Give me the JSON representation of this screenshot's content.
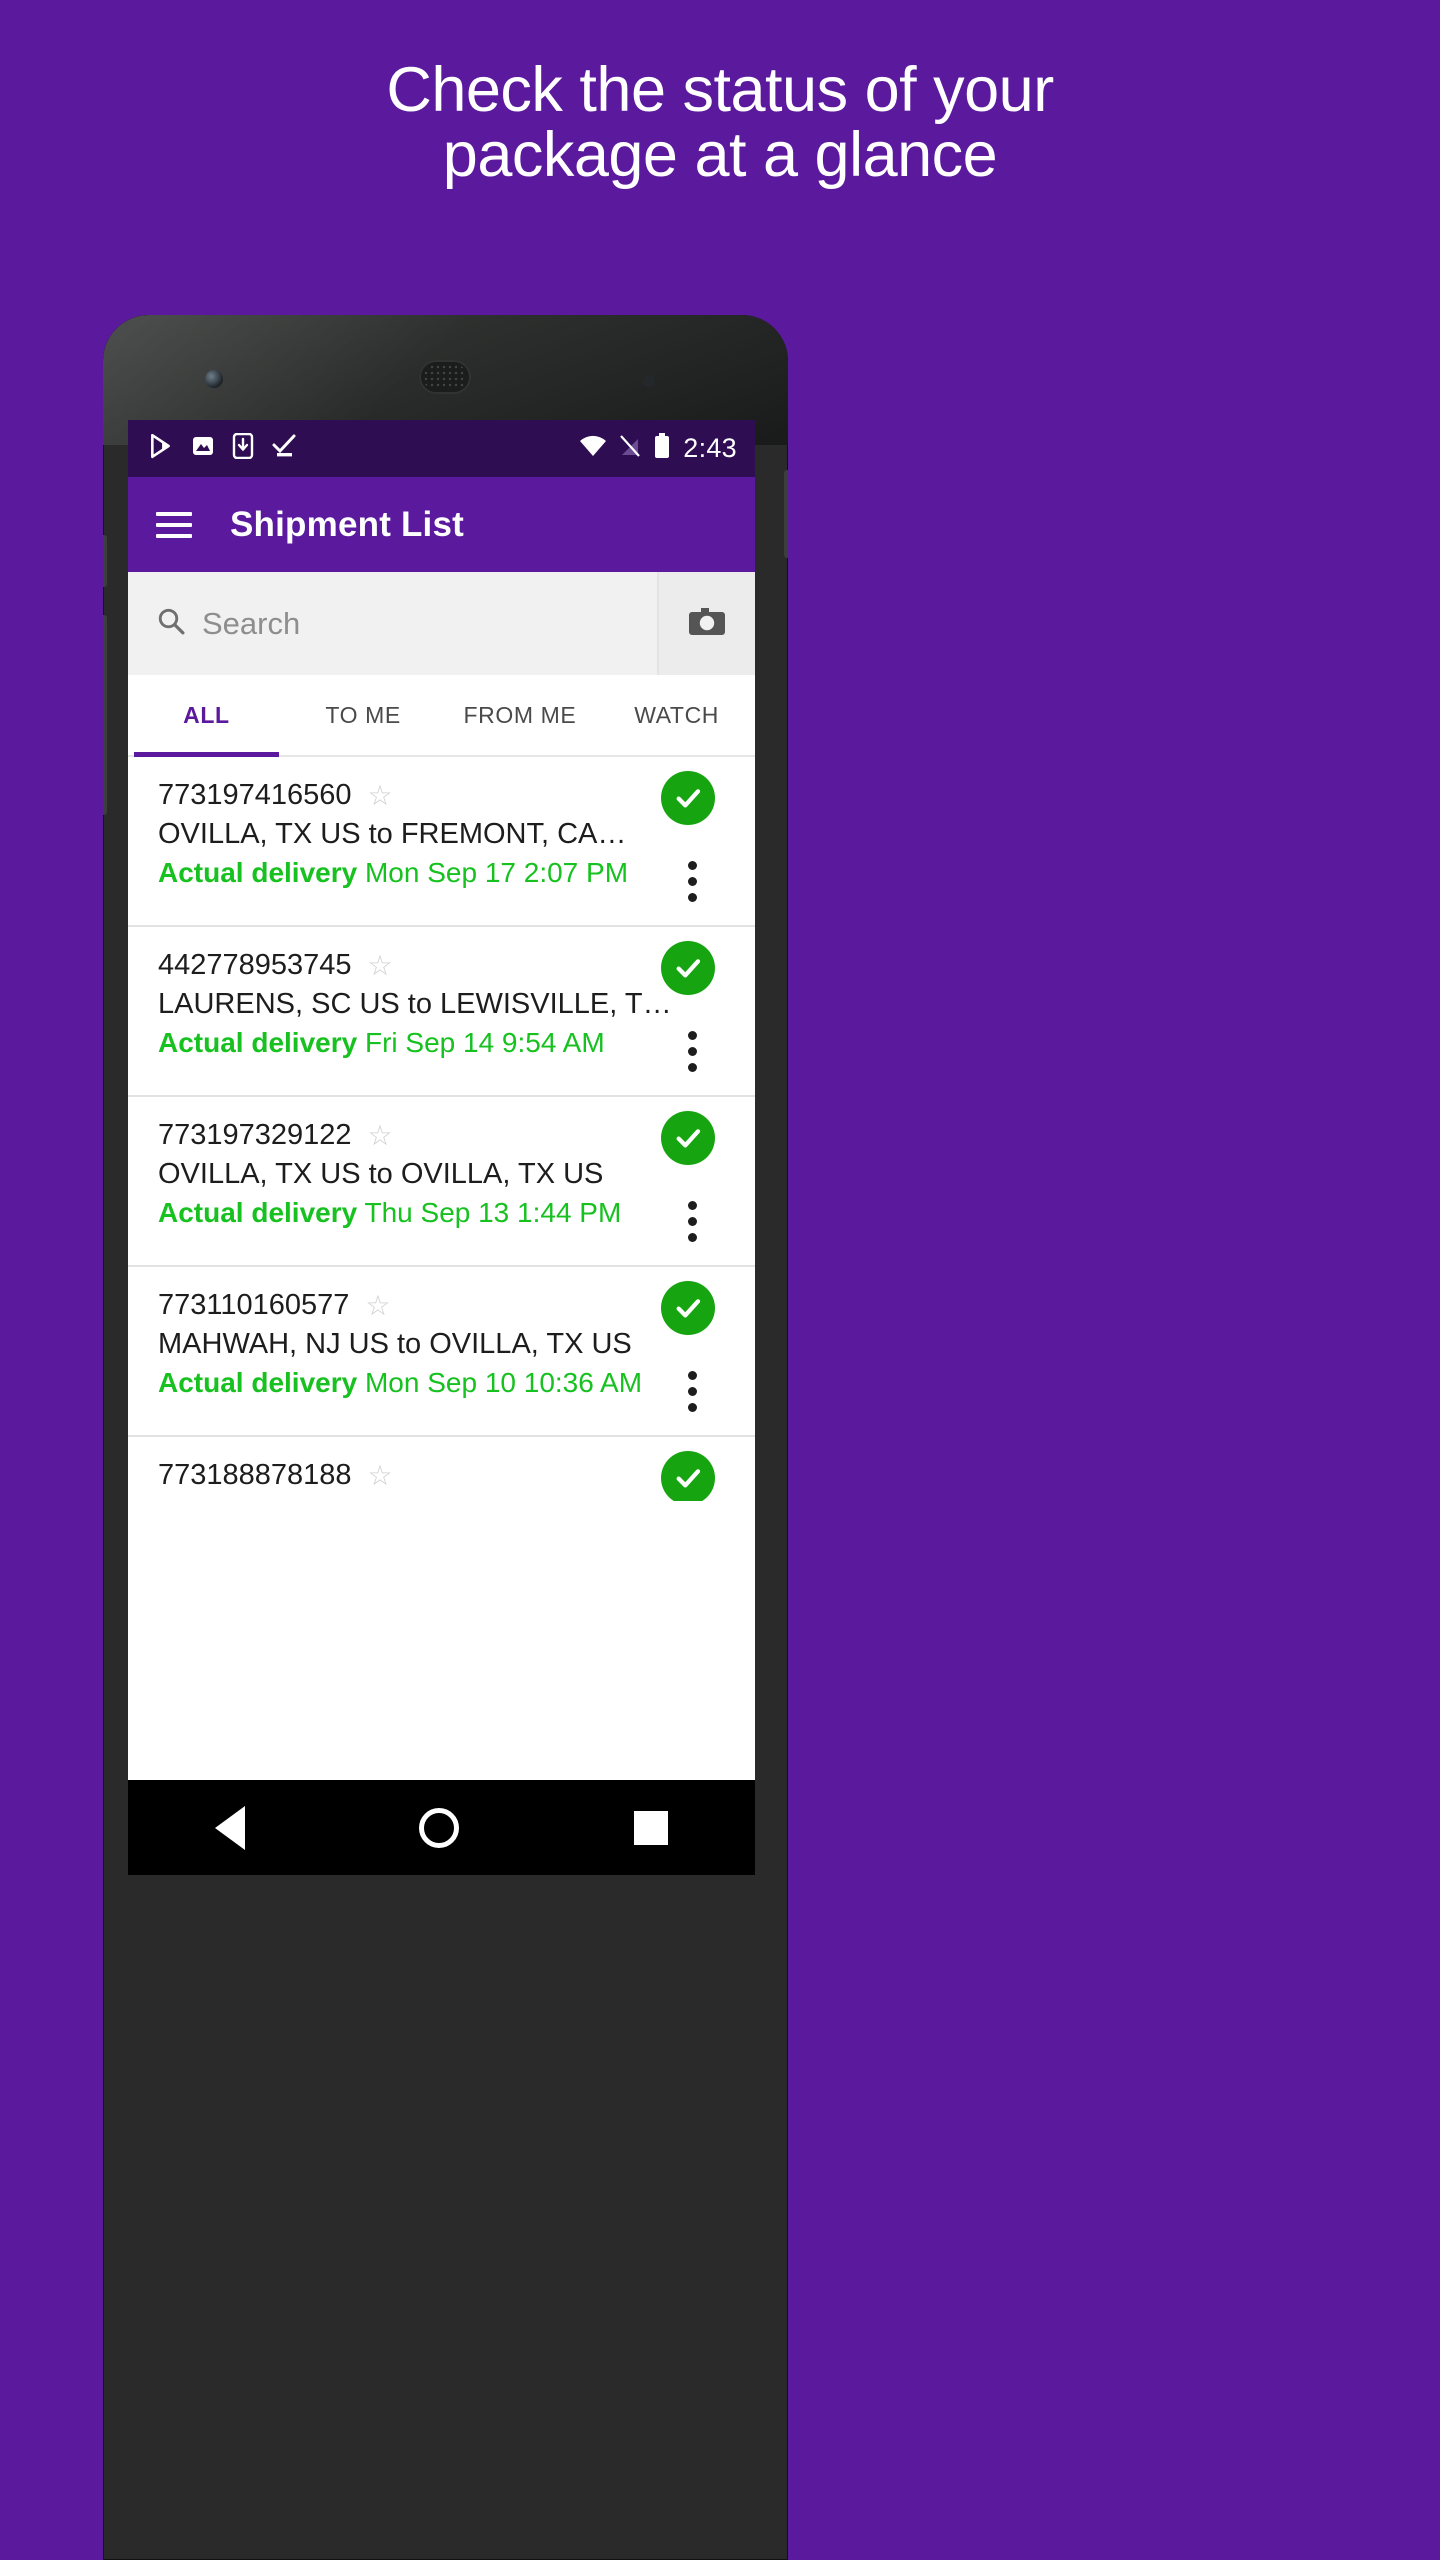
{
  "promo": {
    "line1": "Check the status of your",
    "line2": "package at a glance"
  },
  "colors": {
    "background_purple": "#5b1a9e",
    "statusbar_purple": "#2e0d52",
    "accent_green": "#17c120",
    "badge_green": "#16a510"
  },
  "statusbar": {
    "time": "2:43",
    "left_icons": [
      "play-store-icon",
      "image-icon",
      "download-to-device-icon",
      "check-underline-icon"
    ],
    "right_icons": [
      "wifi-icon",
      "no-sim-icon",
      "battery-full-icon"
    ]
  },
  "appbar": {
    "menu_icon": "hamburger-menu-icon",
    "title": "Shipment List"
  },
  "search": {
    "icon": "search-icon",
    "placeholder": "Search",
    "value": "",
    "camera_icon": "camera-icon"
  },
  "tabs": [
    {
      "label": "ALL",
      "active": true
    },
    {
      "label": "TO ME",
      "active": false
    },
    {
      "label": "FROM ME",
      "active": false
    },
    {
      "label": "WATCH",
      "active": false
    }
  ],
  "shipments": [
    {
      "tracking": "773197416560",
      "route": "OVILLA, TX US to FREMONT, CA…",
      "delivery_label": "Actual delivery",
      "delivery_value": "Mon Sep 17 2:07 PM",
      "star": "☆",
      "status_icon": "check-circle-icon",
      "overflow_icon": "more-vertical-icon"
    },
    {
      "tracking": "442778953745",
      "route": "LAURENS, SC US to LEWISVILLE, T…",
      "delivery_label": "Actual delivery",
      "delivery_value": "Fri Sep 14 9:54 AM",
      "star": "☆",
      "status_icon": "check-circle-icon",
      "overflow_icon": "more-vertical-icon"
    },
    {
      "tracking": "773197329122",
      "route": "OVILLA, TX US to OVILLA, TX US",
      "delivery_label": "Actual delivery",
      "delivery_value": "Thu Sep 13 1:44 PM",
      "star": "☆",
      "status_icon": "check-circle-icon",
      "overflow_icon": "more-vertical-icon"
    },
    {
      "tracking": "773110160577",
      "route": "MAHWAH, NJ US to OVILLA, TX US",
      "delivery_label": "Actual delivery",
      "delivery_value": "Mon Sep 10 10:36 AM",
      "star": "☆",
      "status_icon": "check-circle-icon",
      "overflow_icon": "more-vertical-icon"
    },
    {
      "tracking": "773188878188",
      "route": "",
      "delivery_label": "",
      "delivery_value": "",
      "star": "☆",
      "status_icon": "check-circle-icon",
      "overflow_icon": "more-vertical-icon"
    }
  ],
  "navbar": {
    "back": "back-triangle-icon",
    "home": "home-circle-icon",
    "recents": "recents-square-icon"
  }
}
